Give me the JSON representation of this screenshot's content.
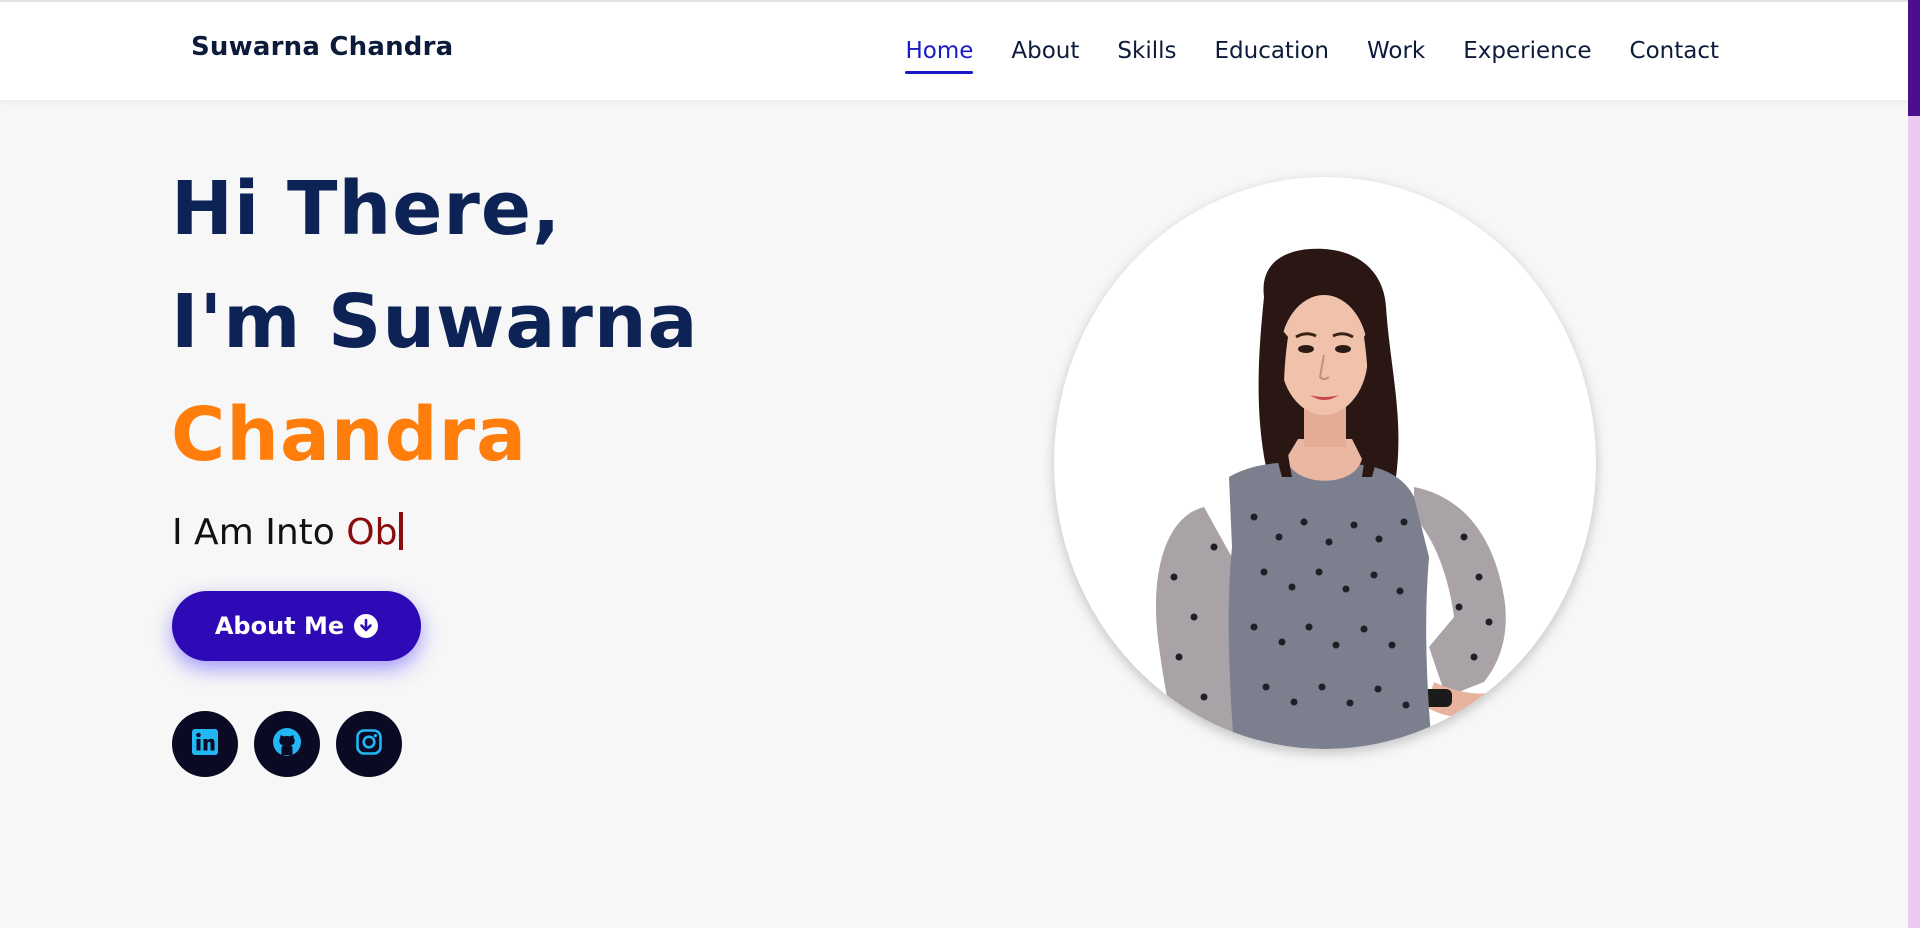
{
  "header": {
    "brand": "Suwarna Chandra",
    "nav": [
      {
        "label": "Home",
        "active": true
      },
      {
        "label": "About",
        "active": false
      },
      {
        "label": "Skills",
        "active": false
      },
      {
        "label": "Education",
        "active": false
      },
      {
        "label": "Work",
        "active": false
      },
      {
        "label": "Experience",
        "active": false
      },
      {
        "label": "Contact",
        "active": false
      }
    ]
  },
  "hero": {
    "line1": "Hi There,",
    "line2": "I'm Suwarna",
    "line3": "Chandra",
    "typed_prefix": "I Am Into",
    "typed_word": "Ob",
    "button_label": "About Me",
    "button_icon": "arrow-down-circle-icon",
    "socials": [
      {
        "icon": "linkedin-icon"
      },
      {
        "icon": "github-icon"
      },
      {
        "icon": "instagram-icon"
      }
    ]
  },
  "colors": {
    "nav_active": "#1a1ac9",
    "heading": "#0d2255",
    "accent_orange": "#ff7d0a",
    "typed_word": "#8b0c0c",
    "button_bg": "#2d0ab6",
    "social_bg": "#0a0a24",
    "social_icon": "#22b7f2",
    "scrollbar_track": "#ecc8f2",
    "scrollbar_thumb": "#4a0e8f"
  }
}
